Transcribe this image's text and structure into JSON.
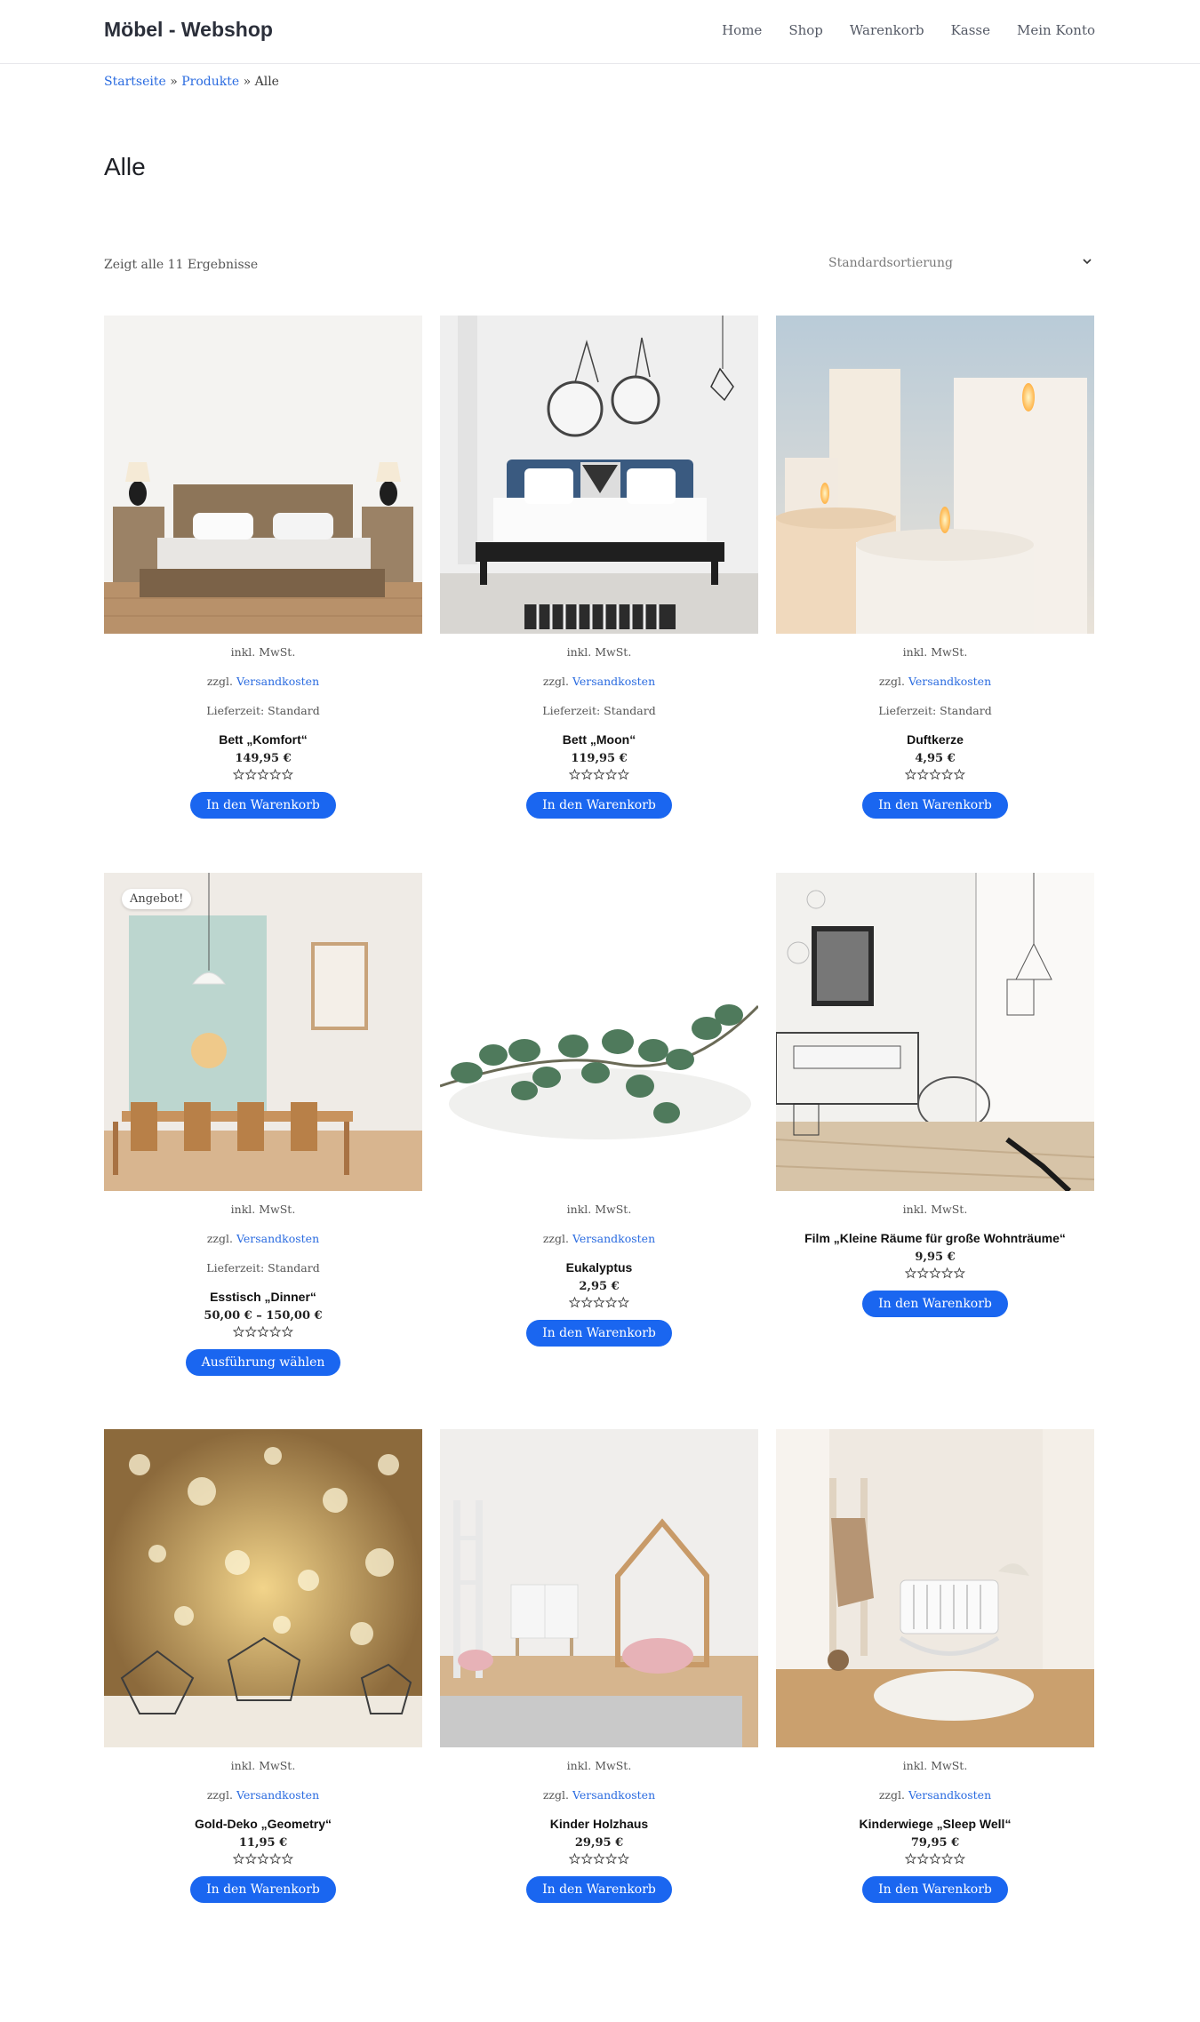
{
  "site": {
    "title": "Möbel - Webshop"
  },
  "nav": [
    {
      "label": "Home"
    },
    {
      "label": "Shop"
    },
    {
      "label": "Warenkorb"
    },
    {
      "label": "Kasse"
    },
    {
      "label": "Mein Konto"
    }
  ],
  "breadcrumb": {
    "home": "Startseite",
    "sep1": " » ",
    "category": "Produkte",
    "sep2": " » ",
    "current": "Alle"
  },
  "page": {
    "title": "Alle",
    "result_count": "Zeigt alle 11 Ergebnisse",
    "sort_label": "Standardsortierung"
  },
  "colors": {
    "accent": "#1a66f0",
    "link": "#2a6be0"
  },
  "products": [
    {
      "image": "bedroom-wood-bed",
      "tax": "inkl. MwSt.",
      "shipping_prefix": "zzgl. ",
      "shipping_link": "Versandkosten",
      "delivery": "Lieferzeit: Standard",
      "title": "Bett „Komfort“",
      "price": "149,95 €",
      "rating": 0,
      "button": "In den Warenkorb"
    },
    {
      "image": "bedroom-blue-bed",
      "tax": "inkl. MwSt.",
      "shipping_prefix": "zzgl. ",
      "shipping_link": "Versandkosten",
      "delivery": "Lieferzeit: Standard",
      "title": "Bett „Moon“",
      "price": "119,95 €",
      "rating": 0,
      "button": "In den Warenkorb"
    },
    {
      "image": "candles",
      "tax": "inkl. MwSt.",
      "shipping_prefix": "zzgl. ",
      "shipping_link": "Versandkosten",
      "delivery": "Lieferzeit: Standard",
      "title": "Duftkerze",
      "price": "4,95 €",
      "rating": 0,
      "button": "In den Warenkorb"
    },
    {
      "image": "dining-room",
      "badge": "Angebot!",
      "tax": "inkl. MwSt.",
      "shipping_prefix": "zzgl. ",
      "shipping_link": "Versandkosten",
      "delivery": "Lieferzeit: Standard",
      "title": "Esstisch „Dinner“",
      "price": "50,00 € – 150,00 €",
      "rating": 0,
      "button": "Ausführung wählen"
    },
    {
      "image": "eucalyptus",
      "tax": "inkl. MwSt.",
      "shipping_prefix": "zzgl. ",
      "shipping_link": "Versandkosten",
      "title": "Eukalyptus",
      "price": "2,95 €",
      "rating": 0,
      "button": "In den Warenkorb"
    },
    {
      "image": "sketch-living-room",
      "tax": "inkl. MwSt.",
      "title": "Film „Kleine Räume für große Wohnträume“",
      "price": "9,95 €",
      "rating": 0,
      "button": "In den Warenkorb"
    },
    {
      "image": "gold-geometry-deco",
      "tax": "inkl. MwSt.",
      "shipping_prefix": "zzgl. ",
      "shipping_link": "Versandkosten",
      "title": "Gold-Deko „Geometry“",
      "price": "11,95 €",
      "rating": 0,
      "button": "In den Warenkorb"
    },
    {
      "image": "kids-room-house-bed",
      "tax": "inkl. MwSt.",
      "shipping_prefix": "zzgl. ",
      "shipping_link": "Versandkosten",
      "title": "Kinder Holzhaus",
      "price": "29,95 €",
      "rating": 0,
      "button": "In den Warenkorb"
    },
    {
      "image": "nursery-cradle",
      "tax": "inkl. MwSt.",
      "shipping_prefix": "zzgl. ",
      "shipping_link": "Versandkosten",
      "title": "Kinderwiege „Sleep Well“",
      "price": "79,95 €",
      "rating": 0,
      "button": "In den Warenkorb"
    }
  ]
}
